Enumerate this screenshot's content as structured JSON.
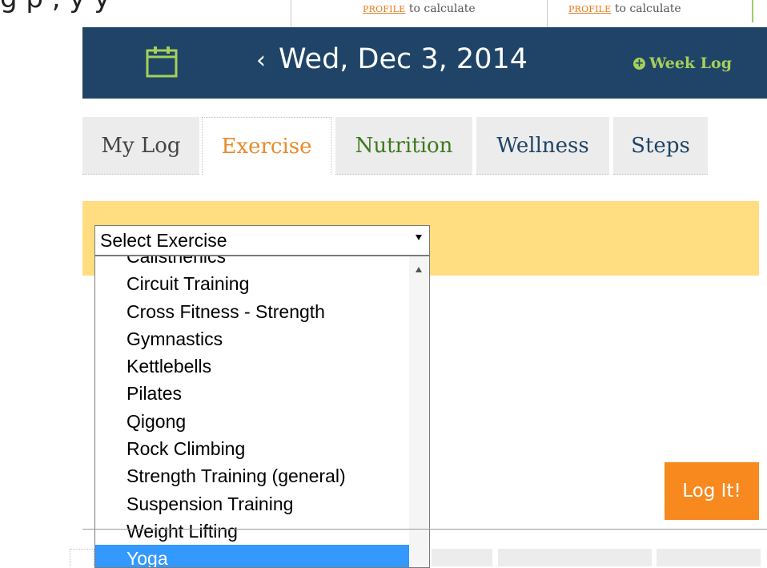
{
  "top_strip": {
    "cut_text": "g    p      ,          y     y",
    "profile_link_1": "PROFILE",
    "profile_suffix_1": " to calculate",
    "profile_link_2": "PROFILE",
    "profile_suffix_2": " to calculate"
  },
  "date_header": {
    "calendar_icon": "calendar-icon",
    "prev_chevron": "‹",
    "date": "Wed, Dec 3, 2014",
    "week_log_label": "Week Log",
    "colors": {
      "background": "#1f4467",
      "accent": "#a6d05a"
    }
  },
  "tabs": [
    {
      "label": "My Log",
      "active": false
    },
    {
      "label": "Exercise",
      "active": true
    },
    {
      "label": "Nutrition",
      "active": false
    },
    {
      "label": "Wellness",
      "active": false
    },
    {
      "label": "Steps",
      "active": false
    }
  ],
  "exercise_select": {
    "value": "Select Exercise",
    "options_visible": [
      "Calisthenics",
      "Circuit Training",
      "Cross Fitness - Strength",
      "Gymnastics",
      "Kettlebells",
      "Pilates",
      "Qigong",
      "Rock Climbing",
      "Strength Training (general)",
      "Suspension Training",
      "Weight Lifting",
      "Yoga"
    ],
    "highlighted_option": "Yoga"
  },
  "log_button_label": "Log It!"
}
